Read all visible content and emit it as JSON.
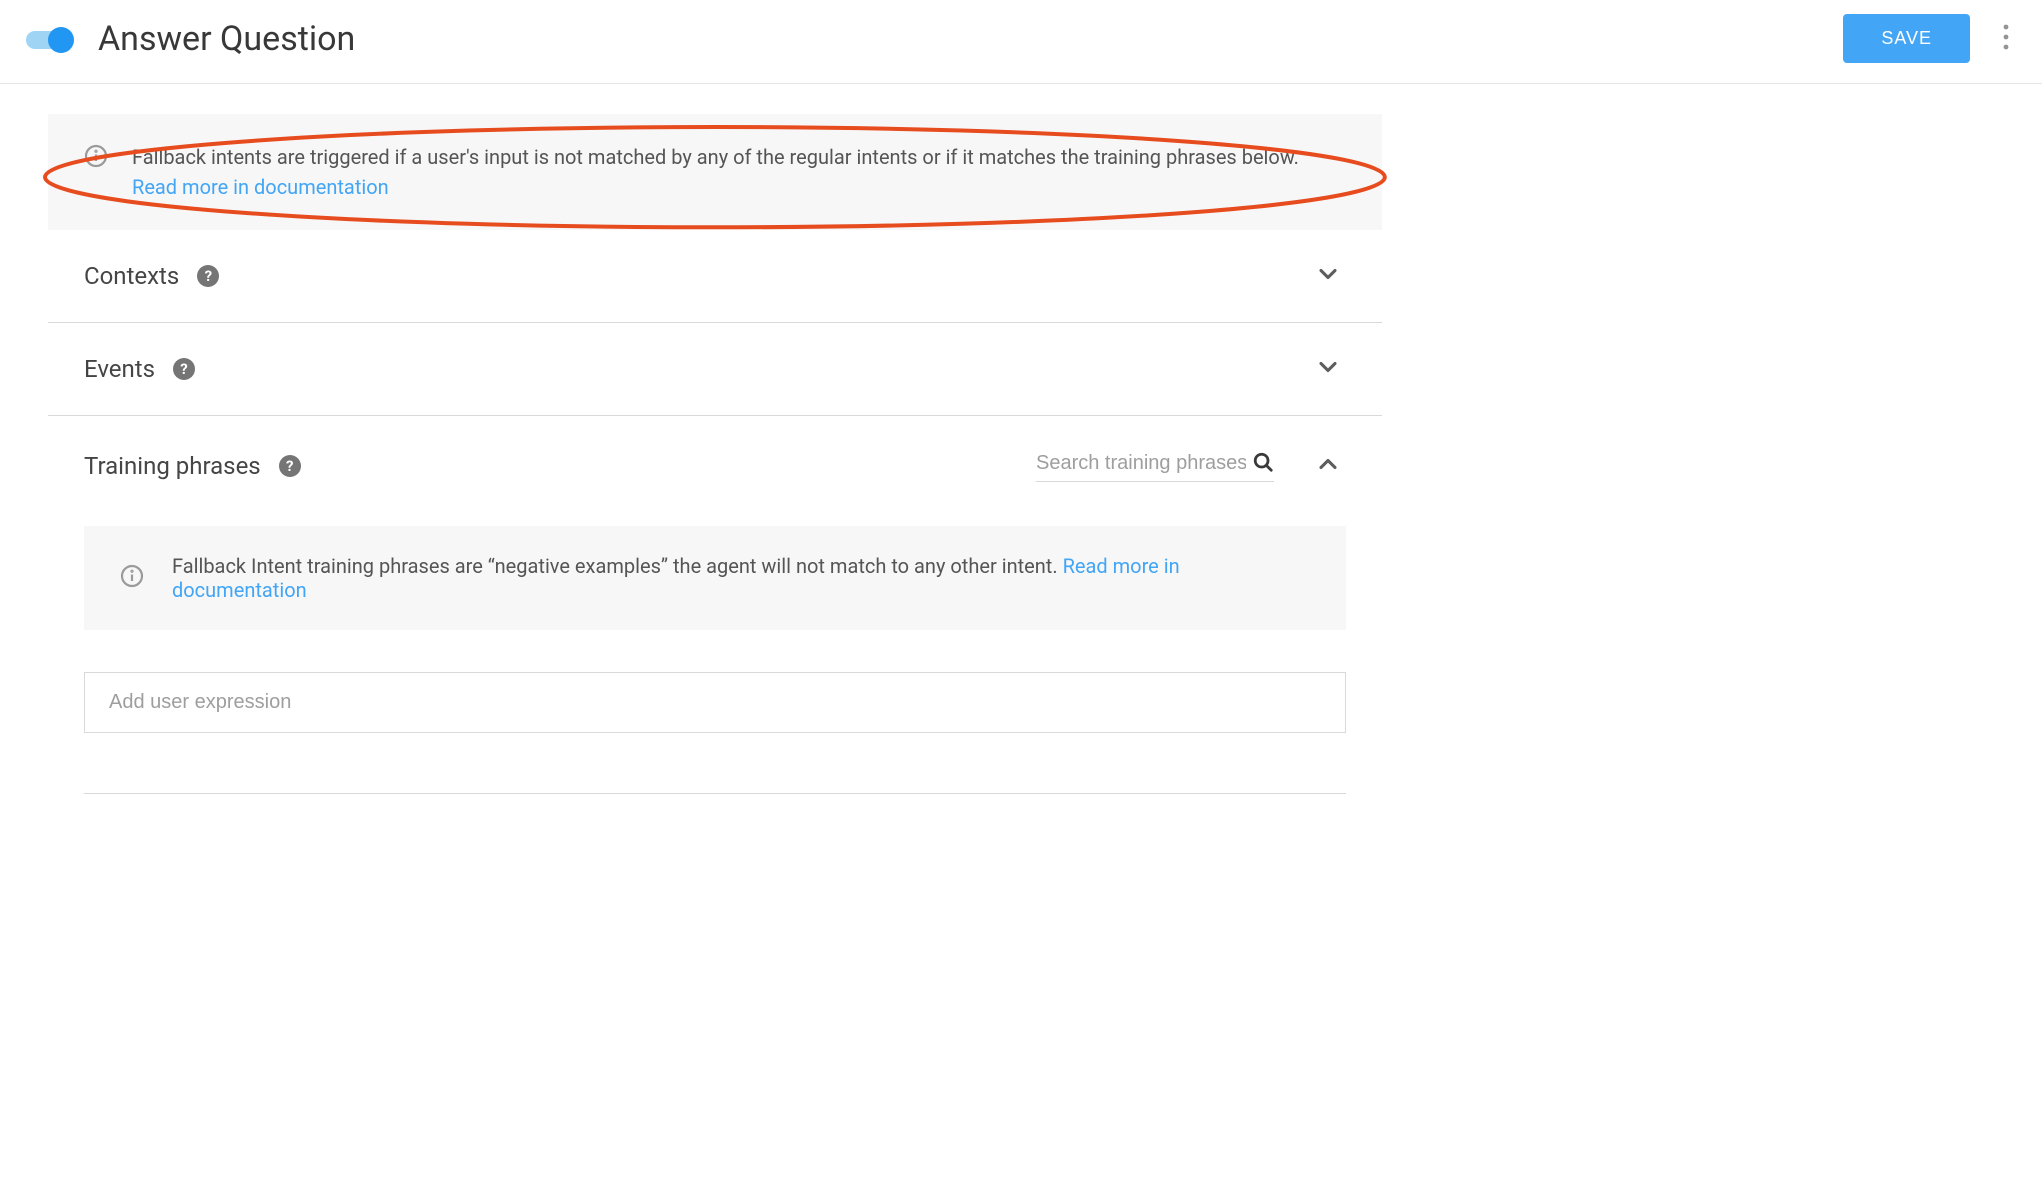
{
  "header": {
    "title": "Answer Question",
    "save_label": "SAVE"
  },
  "banner": {
    "text": "Fallback intents are triggered if a user's input is not matched by any of the regular intents or if it matches the training phrases below. ",
    "link_text": "Read more in documentation"
  },
  "sections": {
    "contexts": {
      "title": "Contexts"
    },
    "events": {
      "title": "Events"
    },
    "training": {
      "title": "Training phrases",
      "search_placeholder": "Search training phrases",
      "info_text": "Fallback Intent training phrases are “negative examples” the agent will not match to any other intent. ",
      "info_link": "Read more in documentation",
      "expression_placeholder": "Add user expression"
    }
  }
}
